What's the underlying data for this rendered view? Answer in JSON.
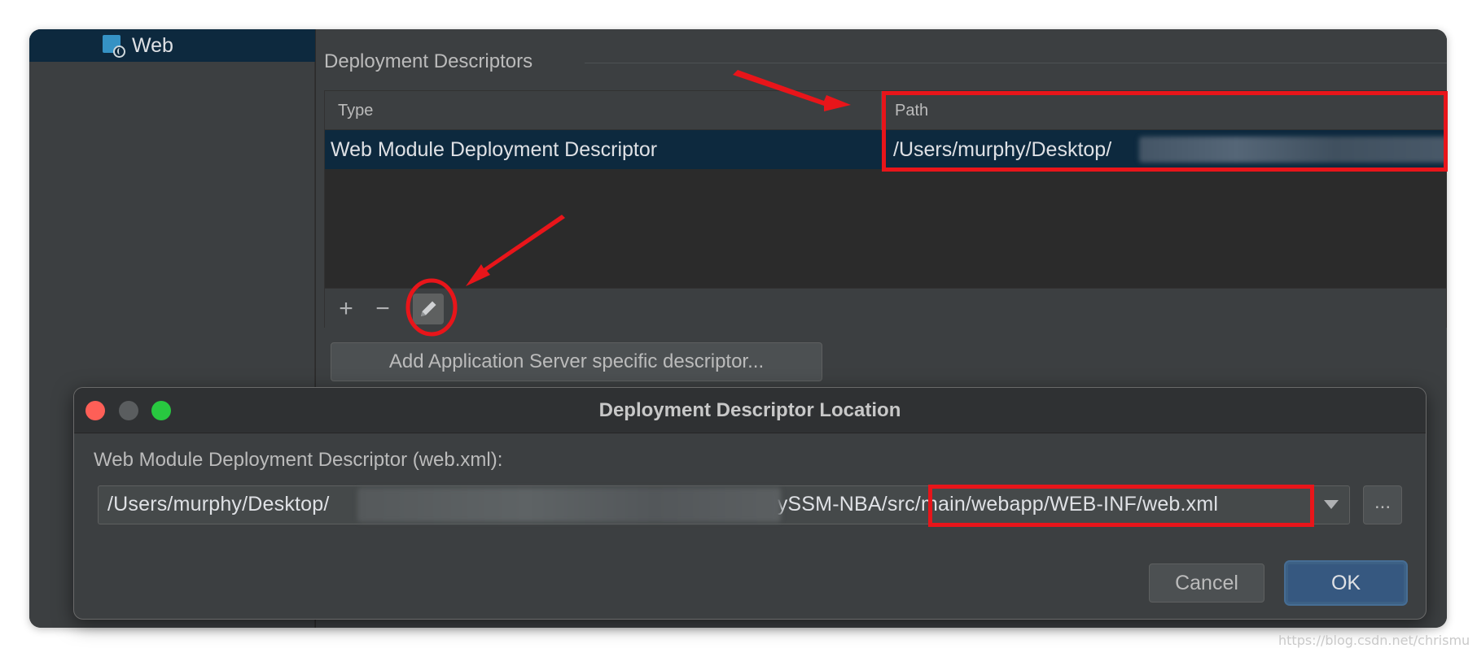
{
  "sidebar": {
    "selected_item": "Web",
    "selected_icon": "web-module-icon"
  },
  "section": {
    "title": "Deployment Descriptors"
  },
  "table": {
    "columns": [
      "Type",
      "Path"
    ],
    "rows": [
      {
        "type": "Web Module Deployment Descriptor",
        "path": "/Users/murphy/Desktop/"
      }
    ]
  },
  "toolbar": {
    "add_icon": "+",
    "remove_icon": "−",
    "edit_icon": "pencil-icon"
  },
  "add_server_descriptor_label": "Add Application Server specific descriptor...",
  "dialog": {
    "title": "Deployment Descriptor Location",
    "field_label": "Web Module Deployment Descriptor (web.xml):",
    "path_prefix": "/Users/murphy/Desktop/",
    "path_suffix": "/MySSM-NBA/src/main/webapp/WEB-INF/web.xml",
    "browse_label": "...",
    "cancel_label": "Cancel",
    "ok_label": "OK"
  },
  "watermark": "https://blog.csdn.net/chrismu",
  "colors": {
    "highlight_box": "#e8151a",
    "selection": "#0d293e",
    "ok_button": "#365880"
  }
}
